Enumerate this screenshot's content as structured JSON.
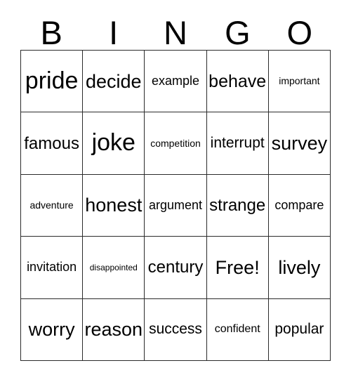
{
  "card": {
    "title": "Bingo Card",
    "header_letters": [
      "B",
      "I",
      "N",
      "G",
      "O"
    ],
    "colors": {
      "background": "#ffffff",
      "text": "#000000",
      "grid_line": "#2b2b2b"
    },
    "grid": {
      "columns": 5,
      "rows": 5,
      "free_space": "Free!",
      "cells": [
        {
          "text": "pride",
          "size": "fs-huge"
        },
        {
          "text": "decide",
          "size": "fs-xxl"
        },
        {
          "text": "example",
          "size": "fs-ml"
        },
        {
          "text": "behave",
          "size": "fs-xxl"
        },
        {
          "text": "important",
          "size": "fs-s"
        },
        {
          "text": "famous",
          "size": "fs-xl"
        },
        {
          "text": "joke",
          "size": "fs-huge"
        },
        {
          "text": "competition",
          "size": "fs-s"
        },
        {
          "text": "interrupt",
          "size": "fs-l"
        },
        {
          "text": "survey",
          "size": "fs-xxl"
        },
        {
          "text": "adventure",
          "size": "fs-s"
        },
        {
          "text": "honest",
          "size": "fs-xxl"
        },
        {
          "text": "argument",
          "size": "fs-ml"
        },
        {
          "text": "strange",
          "size": "fs-xl"
        },
        {
          "text": "compare",
          "size": "fs-ml"
        },
        {
          "text": "invitation",
          "size": "fs-ml"
        },
        {
          "text": "disappointed",
          "size": "fs-xs"
        },
        {
          "text": "century",
          "size": "fs-xl"
        },
        {
          "text": "Free!",
          "size": "fs-xxl"
        },
        {
          "text": "lively",
          "size": "fs-xxl"
        },
        {
          "text": "worry",
          "size": "fs-xxl"
        },
        {
          "text": "reason",
          "size": "fs-xxl"
        },
        {
          "text": "success",
          "size": "fs-l"
        },
        {
          "text": "confident",
          "size": "fs-m"
        },
        {
          "text": "popular",
          "size": "fs-l"
        }
      ]
    }
  }
}
